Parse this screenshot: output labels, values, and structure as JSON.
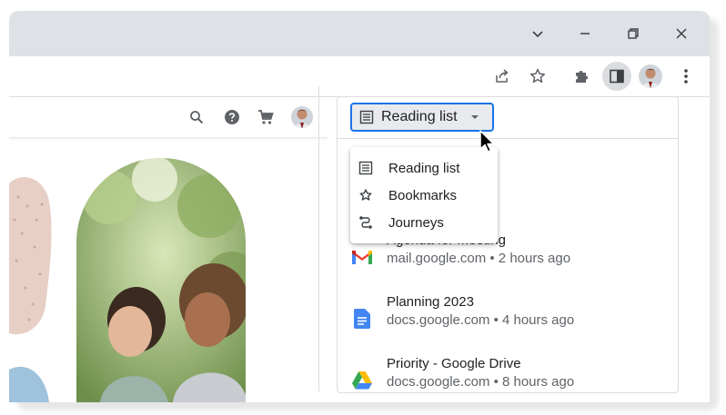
{
  "window": {
    "controls": [
      {
        "name": "tab-search-icon"
      },
      {
        "name": "minimize-icon"
      },
      {
        "name": "restore-icon"
      },
      {
        "name": "close-icon"
      }
    ]
  },
  "toolbar": {
    "icons": [
      "share-icon",
      "bookmark-star-icon",
      "extensions-icon",
      "side-panel-icon",
      "profile-avatar",
      "more-menu-icon"
    ]
  },
  "page": {
    "toolbar_icons": [
      "search-icon",
      "help-icon",
      "cart-icon",
      "profile-avatar"
    ]
  },
  "side_panel": {
    "selector_label": "Reading list",
    "menu": [
      {
        "label": "Reading list",
        "icon": "reading-list-icon"
      },
      {
        "label": "Bookmarks",
        "icon": "star-icon"
      },
      {
        "label": "Journeys",
        "icon": "journeys-icon"
      }
    ],
    "items": [
      {
        "title": "Agenda for meeting",
        "subtitle": "mail.google.com • 2 hours ago",
        "icon": "gmail-icon"
      },
      {
        "title": "Planning 2023",
        "subtitle": "docs.google.com • 4 hours ago",
        "icon": "google-docs-icon"
      },
      {
        "title": "Priority - Google Drive",
        "subtitle": "docs.google.com • 8 hours ago",
        "icon": "google-drive-icon"
      }
    ]
  },
  "colors": {
    "accent": "#1a73e8",
    "titlebar": "#dee1e6"
  }
}
